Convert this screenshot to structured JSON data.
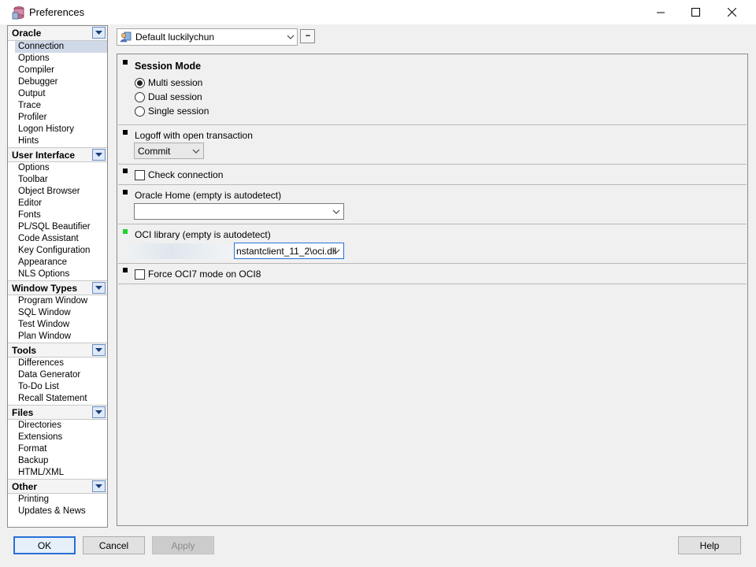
{
  "window": {
    "title": "Preferences"
  },
  "sidebar": {
    "categories": [
      {
        "label": "Oracle",
        "items": [
          "Connection",
          "Options",
          "Compiler",
          "Debugger",
          "Output",
          "Trace",
          "Profiler",
          "Logon History",
          "Hints"
        ]
      },
      {
        "label": "User Interface",
        "items": [
          "Options",
          "Toolbar",
          "Object Browser",
          "Editor",
          "Fonts",
          "PL/SQL Beautifier",
          "Code Assistant",
          "Key Configuration",
          "Appearance",
          "NLS Options"
        ]
      },
      {
        "label": "Window Types",
        "items": [
          "Program Window",
          "SQL Window",
          "Test Window",
          "Plan Window"
        ]
      },
      {
        "label": "Tools",
        "items": [
          "Differences",
          "Data Generator",
          "To-Do List",
          "Recall Statement"
        ]
      },
      {
        "label": "Files",
        "items": [
          "Directories",
          "Extensions",
          "Format",
          "Backup",
          "HTML/XML"
        ]
      },
      {
        "label": "Other",
        "items": [
          "Printing",
          "Updates & News"
        ]
      }
    ],
    "selected": "Connection"
  },
  "profile": {
    "value": "Default luckilychun",
    "more_label": "..."
  },
  "connection": {
    "session_mode": {
      "heading": "Session Mode",
      "options": [
        "Multi session",
        "Dual session",
        "Single session"
      ],
      "selected": "Multi session"
    },
    "logoff": {
      "label": "Logoff with open transaction",
      "value": "Commit"
    },
    "check_connection": {
      "label": "Check connection",
      "checked": false
    },
    "oracle_home": {
      "label": "Oracle Home (empty is autodetect)",
      "value": ""
    },
    "oci_library": {
      "label": "OCI library (empty is autodetect)",
      "value": "nstantclient_11_2\\oci.dll"
    },
    "force_oci7": {
      "label": "Force OCI7 mode on OCI8",
      "checked": false
    }
  },
  "buttons": {
    "ok": "OK",
    "cancel": "Cancel",
    "apply": "Apply",
    "help": "Help"
  },
  "colors": {
    "accent": "#2a6fd6",
    "changed_marker": "#22d12b",
    "selected_item": "#cfd9e8"
  }
}
